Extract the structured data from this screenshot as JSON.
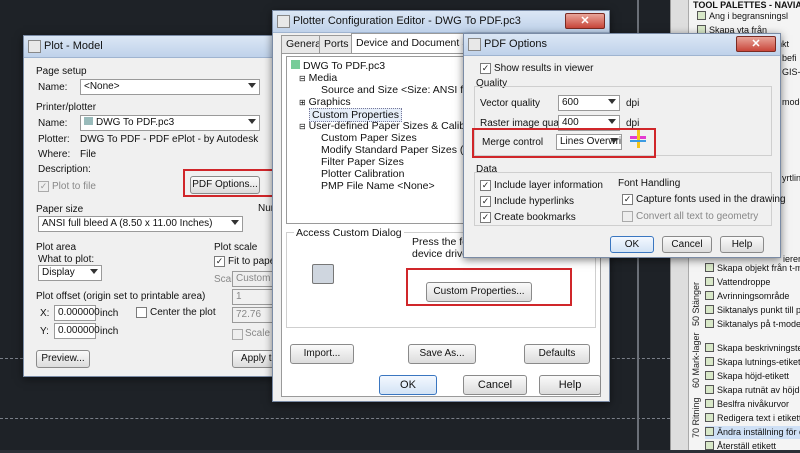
{
  "plot_model": {
    "title": "Plot - Model",
    "page_setup": {
      "heading": "Page setup",
      "name_label": "Name:",
      "name_value": "<None>"
    },
    "printer": {
      "heading": "Printer/plotter",
      "name_label": "Name:",
      "name_value": "DWG To PDF.pc3",
      "plotter_label": "Plotter:",
      "plotter_value": "DWG To PDF - PDF ePlot - by Autodesk",
      "where_label": "Where:",
      "where_value": "File",
      "description_label": "Description:",
      "plot_to_file": "Plot to file",
      "pdf_options_button": "PDF Options..."
    },
    "paper_size": {
      "heading": "Paper size",
      "value": "ANSI full bleed A (8.50 x 11.00 Inches)",
      "num_label": "Num"
    },
    "plot_area": {
      "heading": "Plot area",
      "what_label": "What to plot:",
      "what_value": "Display"
    },
    "plot_scale": {
      "heading": "Plot scale",
      "fit_to_paper": "Fit to paper",
      "scale_label": "Scale:",
      "scale_value": "Custom",
      "value1": "1",
      "value2": "72.76",
      "scale_lineweights": "Scale line"
    },
    "plot_offset": {
      "heading": "Plot offset (origin set to printable area)",
      "x_label": "X:",
      "x_value": "0.000000",
      "x_unit": "inch",
      "y_label": "Y:",
      "y_value": "0.000000",
      "y_unit": "inch",
      "center": "Center the plot"
    },
    "preview_button": "Preview...",
    "apply_button": "Apply to"
  },
  "plotter_config": {
    "title": "Plotter Configuration Editor - DWG To PDF.pc3",
    "tabs": [
      "General",
      "Ports",
      "Device and Document Settings"
    ],
    "tree": [
      "DWG To PDF.pc3",
      "Media",
      "Source and Size <Size: ANSI full blee",
      "Graphics",
      "Custom Properties",
      "User-defined Paper Sizes & Calibration",
      "Custom Paper Sizes",
      "Modify Standard Paper Sizes (Printe",
      "Filter Paper Sizes",
      "Plotter Calibration",
      "PMP File Name <None>"
    ],
    "access_heading": "Access Custom Dialog",
    "access_text1": "Press the foll",
    "access_text2": "device driver",
    "custom_properties_button": "Custom Properties...",
    "import_button": "Import...",
    "save_as_button": "Save As...",
    "defaults_button": "Defaults",
    "ok_button": "OK",
    "cancel_button": "Cancel",
    "help_button": "Help"
  },
  "pdf_options": {
    "title": "PDF Options",
    "show_results": "Show results in viewer",
    "quality_heading": "Quality",
    "vector_label": "Vector quality",
    "vector_value": "600",
    "vector_unit": "dpi",
    "raster_label": "Raster image quality",
    "raster_value": "400",
    "raster_unit": "dpi",
    "merge_label": "Merge control",
    "merge_value": "Lines Overwrite",
    "data_heading": "Data",
    "include_layer": "Include layer information",
    "include_hyperlinks": "Include hyperlinks",
    "create_bookmarks": "Create bookmarks",
    "font_heading": "Font Handling",
    "capture_fonts": "Capture fonts used in the drawing",
    "convert_text": "Convert all text to geometry",
    "ok_button": "OK",
    "cancel_button": "Cancel",
    "help_button": "Help"
  },
  "tool_palettes": {
    "title": "TOOL PALETTES - NAVIATE",
    "top_items": [
      "Ang i begransningsl",
      "Skapa yta från",
      "punkt",
      "befi",
      "GIS-d",
      "modell",
      "yrtlin"
    ],
    "items": [
      "Skapa objekt från t-model",
      "Vattendroppe",
      "Avrinningsområde",
      "Siktanalys punkt till punkt",
      "Siktanalys på t-modell",
      "Skapa beskrivningstext",
      "Skapa lutnings-etikett",
      "Skapa höjd-etikett",
      "Skapa rutnät av höjd-etike",
      "Beslfra nivåkurvor",
      "Redigera text i etikett",
      "Ändra inställning för etike",
      "Återställ etikett"
    ],
    "vtabs": [
      "50 Stänger",
      "60 Mark-lager",
      "70 Ritning"
    ],
    "edge_text": "ierer"
  }
}
